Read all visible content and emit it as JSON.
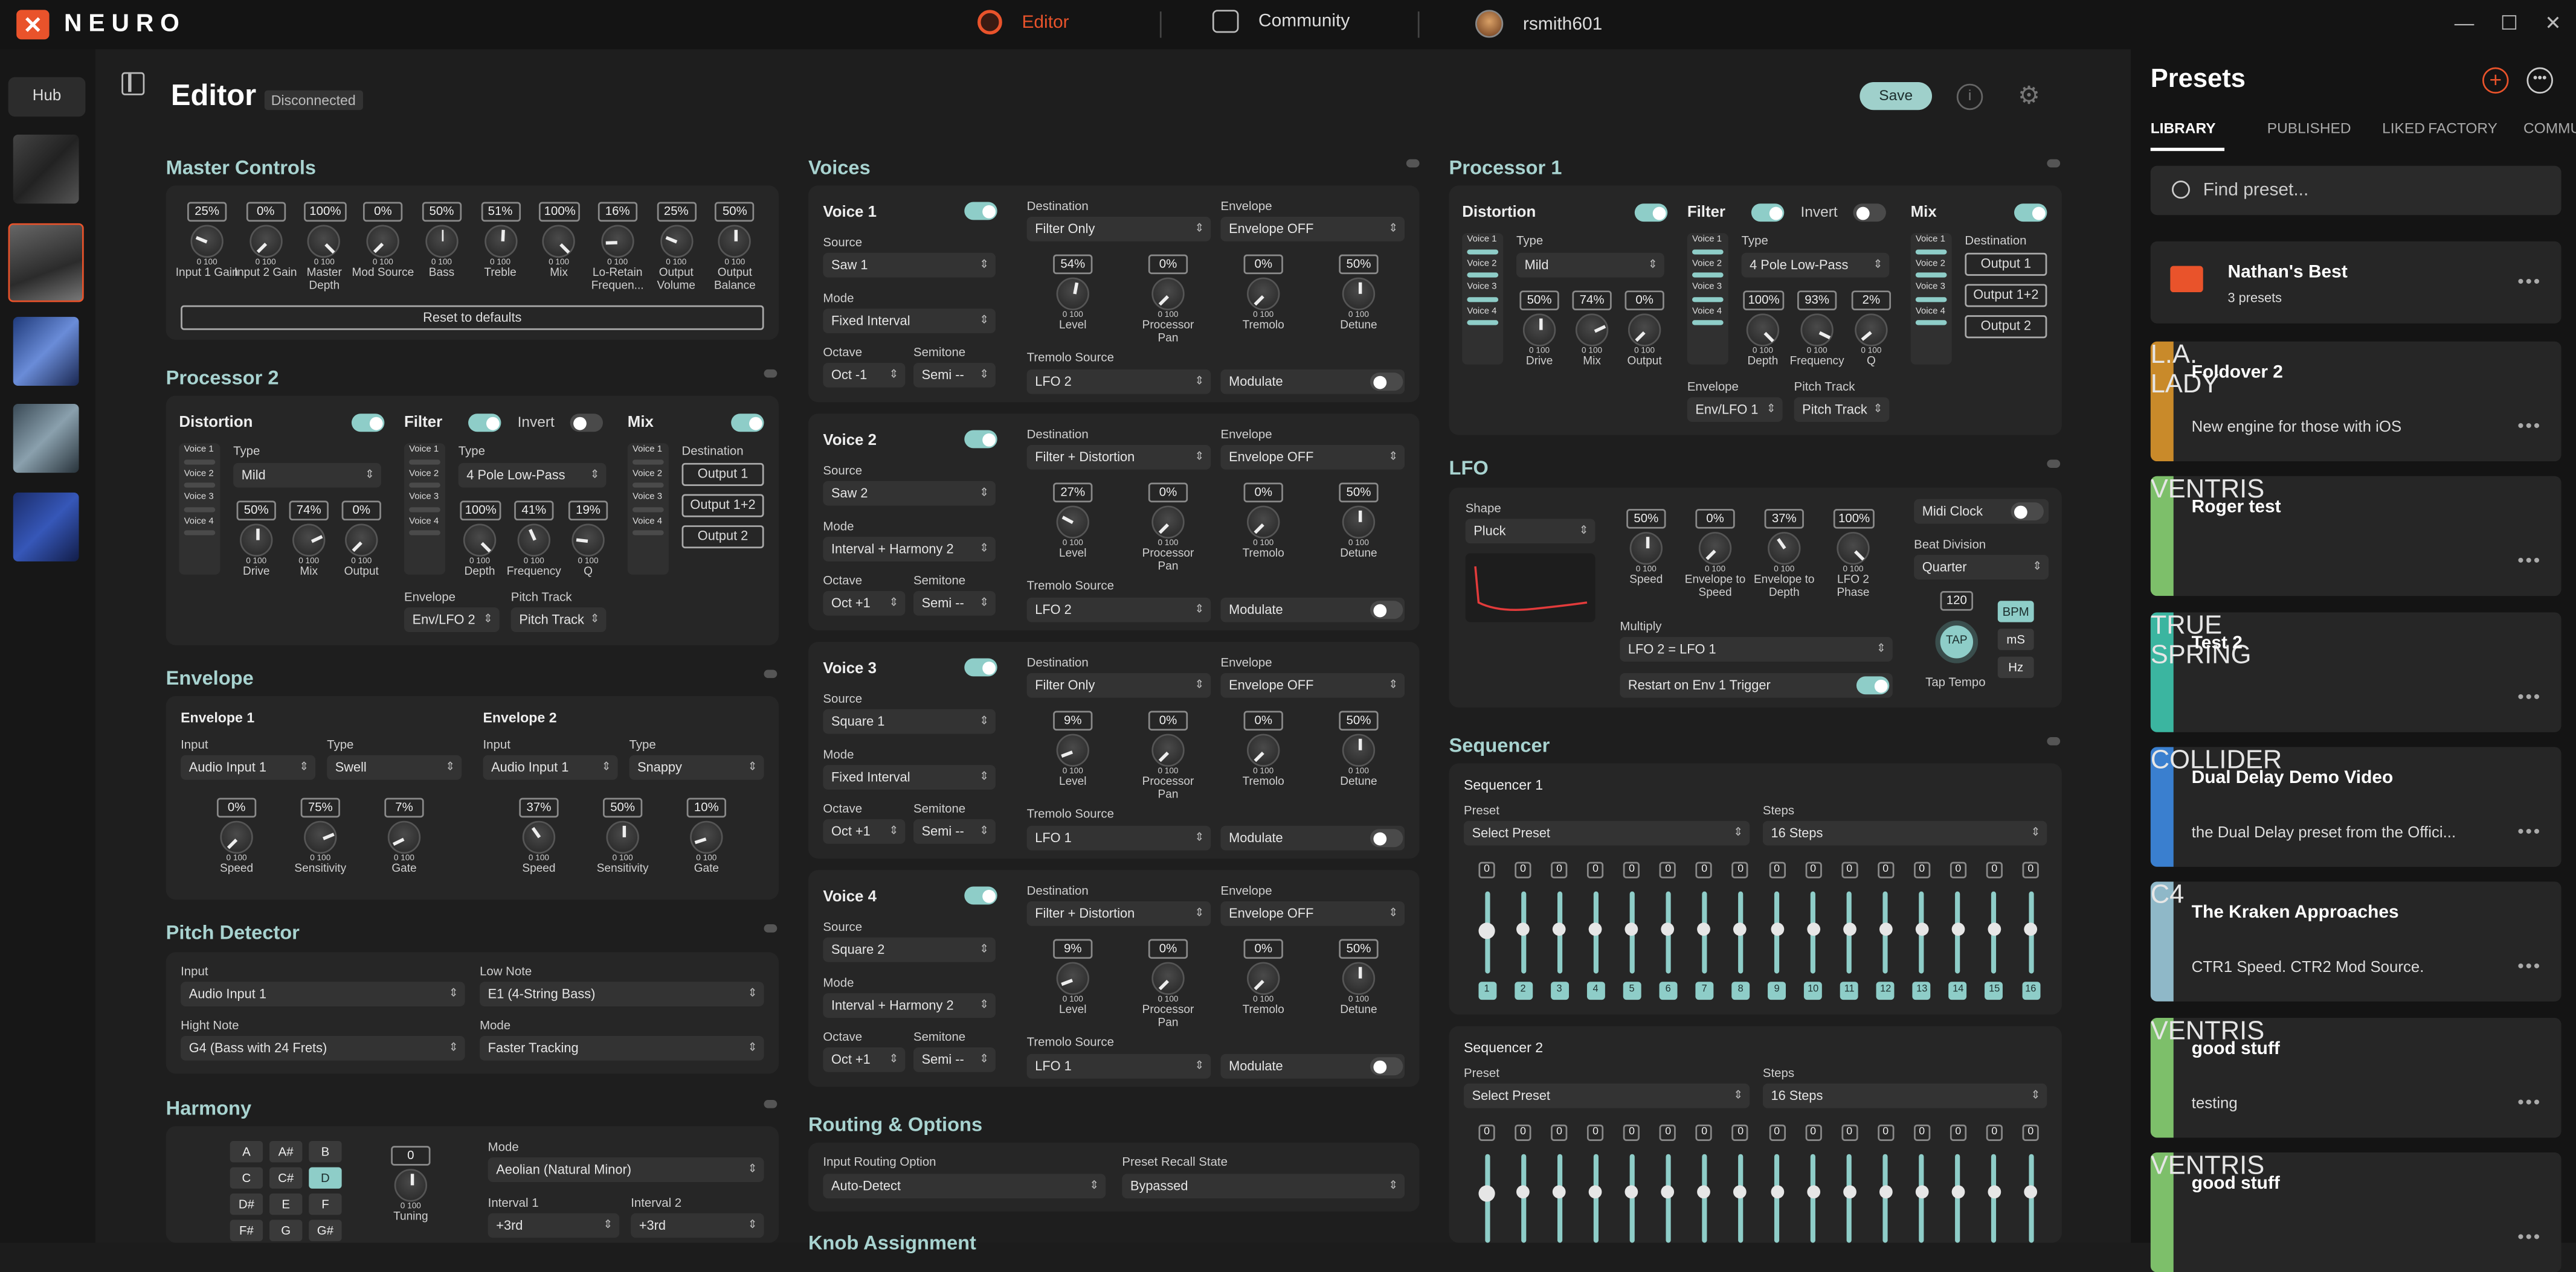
{
  "app": {
    "logo": "NEURO",
    "logo_mark": "✕"
  },
  "titlebar": {
    "tabs": [
      "Editor",
      "Community",
      "rsmith601"
    ],
    "controls": [
      "—",
      "☐",
      "✕"
    ]
  },
  "rail": {
    "hub": "Hub"
  },
  "editor": {
    "title": "Editor",
    "status": "Disconnected",
    "save": "Save",
    "info": "i",
    "settings": "⚙"
  },
  "colors": {
    "accent": "#8ecdc8",
    "brand": "#e9532b",
    "editor_tab": "#e9532b",
    "title": "#a8d3d0"
  },
  "master": {
    "title": "Master Controls",
    "knobs": [
      {
        "value": "25%",
        "label": "Input 1 Gain"
      },
      {
        "value": "0%",
        "label": "Input 2 Gain"
      },
      {
        "value": "100%",
        "label": "Master Depth"
      },
      {
        "value": "0%",
        "label": "Mod Source"
      },
      {
        "value": "50%",
        "label": "Bass"
      },
      {
        "value": "51%",
        "label": "Treble"
      },
      {
        "value": "100%",
        "label": "Mix"
      },
      {
        "value": "16%",
        "label": "Lo-Retain Frequen..."
      },
      {
        "value": "25%",
        "label": "Output Volume"
      },
      {
        "value": "50%",
        "label": "Output Balance"
      }
    ],
    "reset": "Reset to defaults"
  },
  "proc2": {
    "title": "Processor 2",
    "distortion": "Distortion",
    "filter": "Filter",
    "invert": "Invert",
    "mix": "Mix",
    "voices": [
      "Voice 1",
      "Voice 2",
      "Voice 3",
      "Voice 4"
    ],
    "type_label": "Type",
    "dist_type": "Mild",
    "filter_type": "4 Pole Low-Pass",
    "dist_knobs": [
      {
        "value": "50%",
        "label": "Drive"
      },
      {
        "value": "74%",
        "label": "Mix"
      },
      {
        "value": "0%",
        "label": "Output"
      }
    ],
    "filter_knobs": [
      {
        "value": "100%",
        "label": "Depth"
      },
      {
        "value": "41%",
        "label": "Frequency"
      },
      {
        "value": "19%",
        "label": "Q"
      }
    ],
    "envelope_label": "Envelope",
    "envelope": "Env/LFO 2",
    "pitch_label": "Pitch Track",
    "pitch": "Pitch Track",
    "dest_label": "Destination",
    "outputs": [
      "Output 1",
      "Output 1+2",
      "Output 2"
    ]
  },
  "envelope": {
    "title": "Envelope",
    "env1": {
      "title": "Envelope 1",
      "input_label": "Input",
      "input": "Audio Input 1",
      "type_label": "Type",
      "type": "Swell",
      "knobs": [
        {
          "value": "0%",
          "label": "Speed"
        },
        {
          "value": "75%",
          "label": "Sensitivity"
        },
        {
          "value": "7%",
          "label": "Gate"
        }
      ]
    },
    "env2": {
      "title": "Envelope 2",
      "input_label": "Input",
      "input": "Audio Input 1",
      "type_label": "Type",
      "type": "Snappy",
      "knobs": [
        {
          "value": "37%",
          "label": "Speed"
        },
        {
          "value": "50%",
          "label": "Sensitivity"
        },
        {
          "value": "10%",
          "label": "Gate"
        }
      ]
    }
  },
  "pitch": {
    "title": "Pitch Detector",
    "input_label": "Input",
    "input": "Audio Input 1",
    "low_label": "Low Note",
    "low": "E1 (4-String Bass)",
    "high_label": "Hight Note",
    "high": "G4 (Bass with 24 Frets)",
    "mode_label": "Mode",
    "mode": "Faster Tracking"
  },
  "harmony": {
    "title": "Harmony",
    "keys": [
      "A",
      "A#",
      "B",
      "C",
      "C#",
      "D",
      "D#",
      "E",
      "F",
      "F#",
      "G",
      "G#"
    ],
    "active_key": "D",
    "tuning_value": "0",
    "tuning_label": "Tuning",
    "mode_label": "Mode",
    "mode": "Aeolian (Natural Minor)",
    "interval1_label": "Interval 1",
    "interval1": "+3rd",
    "interval2_label": "Interval 2",
    "interval2": "+3rd"
  },
  "voices": {
    "title": "Voices",
    "labels": {
      "source": "Source",
      "mode": "Mode",
      "octave": "Octave",
      "semitone": "Semitone",
      "destination": "Destination",
      "envelope": "Envelope",
      "tremolo_source": "Tremolo Source",
      "modulate": "Modulate"
    },
    "knob_labels": [
      "Level",
      "Processor Pan",
      "Tremolo",
      "Detune"
    ],
    "list": [
      {
        "name": "Voice 1",
        "source": "Saw 1",
        "mode": "Fixed Interval",
        "octave": "Oct -1",
        "semitone": "Semi --",
        "destination": "Filter Only",
        "envelope": "Envelope OFF",
        "tremolo": "LFO 2",
        "knobs": [
          "54%",
          "0%",
          "0%",
          "50%"
        ]
      },
      {
        "name": "Voice 2",
        "source": "Saw 2",
        "mode": "Interval + Harmony 2",
        "octave": "Oct +1",
        "semitone": "Semi --",
        "destination": "Filter + Distortion",
        "envelope": "Envelope OFF",
        "tremolo": "LFO 2",
        "knobs": [
          "27%",
          "0%",
          "0%",
          "50%"
        ]
      },
      {
        "name": "Voice 3",
        "source": "Square 1",
        "mode": "Fixed Interval",
        "octave": "Oct +1",
        "semitone": "Semi --",
        "destination": "Filter Only",
        "envelope": "Envelope OFF",
        "tremolo": "LFO 1",
        "knobs": [
          "9%",
          "0%",
          "0%",
          "50%"
        ]
      },
      {
        "name": "Voice 4",
        "source": "Square 2",
        "mode": "Interval + Harmony 2",
        "octave": "Oct +1",
        "semitone": "Semi --",
        "destination": "Filter + Distortion",
        "envelope": "Envelope OFF",
        "tremolo": "LFO 1",
        "knobs": [
          "9%",
          "0%",
          "0%",
          "50%"
        ]
      }
    ]
  },
  "routing": {
    "title": "Routing & Options",
    "input_label": "Input Routing Option",
    "input": "Auto-Detect",
    "recall_label": "Preset Recall State",
    "recall": "Bypassed",
    "next_title": "Knob Assignment"
  },
  "proc1": {
    "title": "Processor 1",
    "distortion": "Distortion",
    "filter": "Filter",
    "invert": "Invert",
    "mix": "Mix",
    "voices": [
      "Voice 1",
      "Voice 2",
      "Voice 3",
      "Voice 4"
    ],
    "type_label": "Type",
    "dist_type": "Mild",
    "filter_type": "4 Pole Low-Pass",
    "dist_knobs": [
      {
        "value": "50%",
        "label": "Drive"
      },
      {
        "value": "74%",
        "label": "Mix"
      },
      {
        "value": "0%",
        "label": "Output"
      }
    ],
    "filter_knobs": [
      {
        "value": "100%",
        "label": "Depth"
      },
      {
        "value": "93%",
        "label": "Frequency"
      },
      {
        "value": "2%",
        "label": "Q"
      }
    ],
    "envelope_label": "Envelope",
    "envelope": "Env/LFO 1",
    "pitch_label": "Pitch Track",
    "pitch": "Pitch Track",
    "dest_label": "Destination",
    "outputs": [
      "Output 1",
      "Output 1+2",
      "Output 2"
    ]
  },
  "lfo": {
    "title": "LFO",
    "shape_label": "Shape",
    "shape": "Pluck",
    "knobs": [
      {
        "value": "50%",
        "label": "Speed"
      },
      {
        "value": "0%",
        "label": "Envelope to Speed"
      },
      {
        "value": "37%",
        "label": "Envelope to Depth"
      },
      {
        "value": "100%",
        "label": "LFO 2 Phase"
      }
    ],
    "multiply_label": "Multiply",
    "multiply": "LFO 2 = LFO 1",
    "restart": "Restart on Env 1 Trigger",
    "midi_clock": "Midi Clock",
    "beat_label": "Beat Division",
    "beat": "Quarter",
    "bpm_value": "120",
    "tap": "TAP",
    "tap_label": "Tap Tempo",
    "units": [
      "BPM",
      "mS",
      "Hz"
    ]
  },
  "sequencer": {
    "title": "Sequencer",
    "seq1": {
      "title": "Sequencer 1",
      "preset_label": "Preset",
      "preset": "Select Preset",
      "steps_label": "Steps",
      "steps": "16 Steps"
    },
    "seq2": {
      "title": "Sequencer 2",
      "preset_label": "Preset",
      "preset": "Select Preset",
      "steps_label": "Steps",
      "steps": "16 Steps"
    },
    "step_values": [
      "0",
      "0",
      "0",
      "0",
      "0",
      "0",
      "0",
      "0",
      "0",
      "0",
      "0",
      "0",
      "0",
      "0",
      "0",
      "0"
    ],
    "step_numbers": [
      "1",
      "2",
      "3",
      "4",
      "5",
      "6",
      "7",
      "8",
      "9",
      "10",
      "11",
      "12",
      "13",
      "14",
      "15",
      "16"
    ]
  },
  "presets": {
    "title": "Presets",
    "tabs": [
      "LIBRARY",
      "PUBLISHED",
      "LIKED",
      "FACTORY",
      "COMMU"
    ],
    "search_placeholder": "Find preset...",
    "folder": {
      "name": "Nathan's Best",
      "count": "3 presets"
    },
    "items": [
      {
        "tag": "L.A. LADY",
        "name": "Foldover 2",
        "desc": "New engine for those with iOS",
        "color": "#c98a2a"
      },
      {
        "tag": "VENTRIS",
        "name": "Roger test",
        "desc": "",
        "color": "#7dbf6a"
      },
      {
        "tag": "TRUE SPRING",
        "name": "Test 2",
        "desc": "",
        "color": "#3bb5a0"
      },
      {
        "tag": "COLLIDER",
        "name": "Dual Delay Demo Video",
        "desc": "the Dual Delay preset from the Offici...",
        "color": "#3a7fcf"
      },
      {
        "tag": "C4",
        "name": "The Kraken Approaches",
        "desc": "CTR1 Speed. CTR2 Mod Source.",
        "color": "#8fb8c8"
      },
      {
        "tag": "VENTRIS",
        "name": "good stuff",
        "desc": "testing",
        "color": "#7dbf6a"
      },
      {
        "tag": "VENTRIS",
        "name": "good stuff",
        "desc": "",
        "color": "#7dbf6a"
      }
    ],
    "more": "•••"
  }
}
